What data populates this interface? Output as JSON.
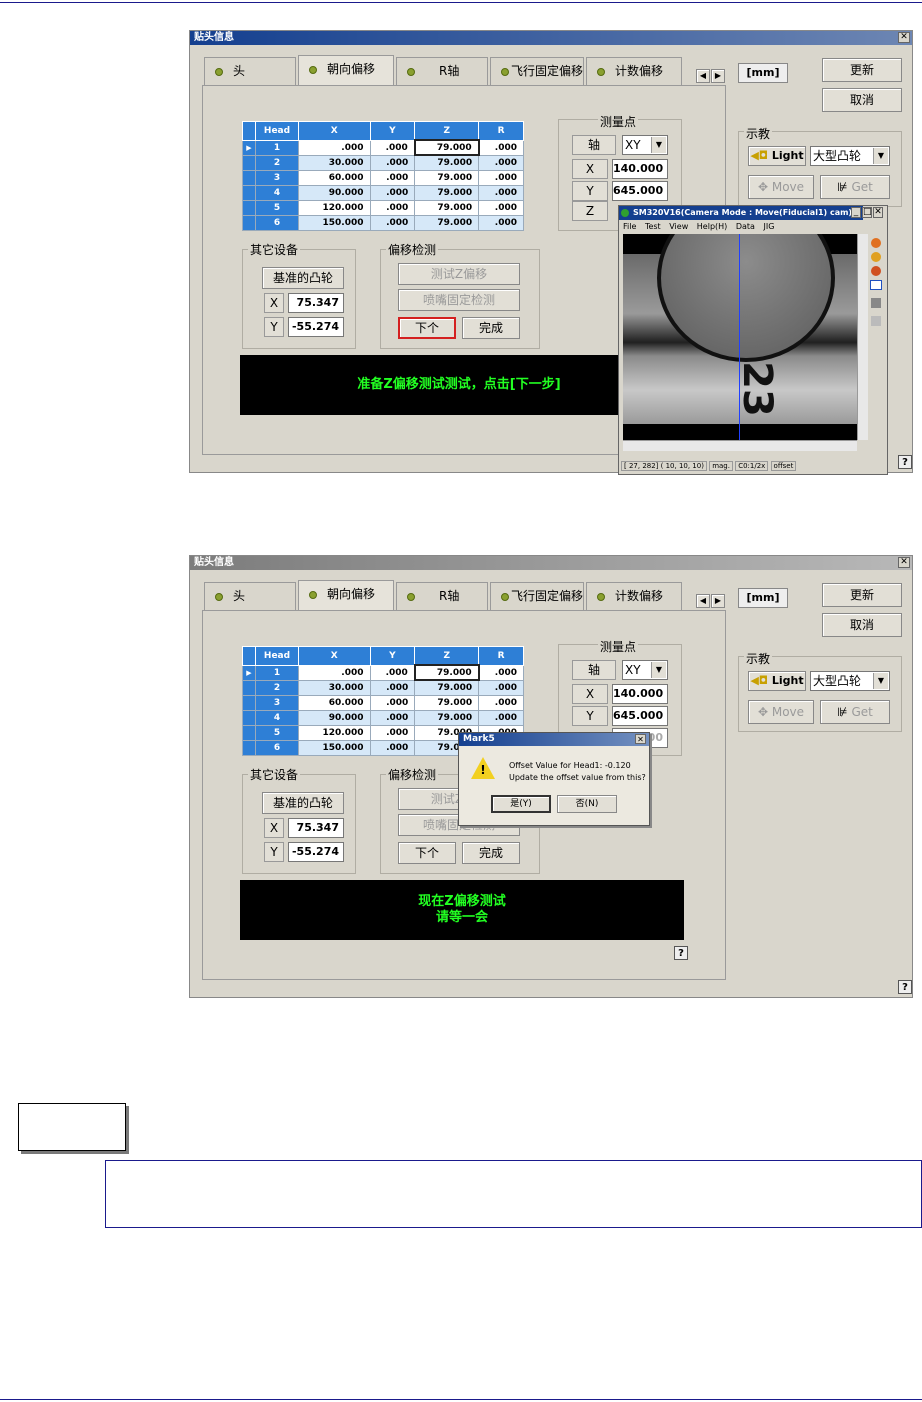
{
  "window_title": "贴头信息",
  "tabs": [
    "头",
    "朝向偏移",
    "R轴",
    "飞行固定偏移",
    "计数偏移"
  ],
  "unit": "[mm]",
  "buttons": {
    "update": "更新",
    "cancel": "取消",
    "next": "下个",
    "finish": "完成",
    "test_z": "测试Z偏移",
    "nozzle_check": "喷嘴固定检测",
    "move": "Move",
    "get": "Get",
    "light": "Light"
  },
  "teach": {
    "label": "示教",
    "camera_select": "大型凸轮"
  },
  "measure": {
    "label": "测量点",
    "axis_label": "轴",
    "axis_value": "XY",
    "x_label": "X",
    "x_value": "140.000",
    "y_label": "Y",
    "y_value": "645.000",
    "z_label": "Z",
    "z_value": "000"
  },
  "table": {
    "headers": [
      "Head",
      "X",
      "Y",
      "Z",
      "R"
    ],
    "rows": [
      [
        "1",
        ".000",
        ".000",
        "79.000",
        ".000"
      ],
      [
        "2",
        "30.000",
        ".000",
        "79.000",
        ".000"
      ],
      [
        "3",
        "60.000",
        ".000",
        "79.000",
        ".000"
      ],
      [
        "4",
        "90.000",
        ".000",
        "79.000",
        ".000"
      ],
      [
        "5",
        "120.000",
        ".000",
        "79.000",
        ".000"
      ],
      [
        "6",
        "150.000",
        ".000",
        "79.000",
        ".000"
      ]
    ]
  },
  "other": {
    "label": "其它设备",
    "ref_camera": "基准的凸轮",
    "x_label": "X",
    "x_value": "75.347",
    "y_label": "Y",
    "y_value": "-55.274"
  },
  "offset_check": {
    "label": "偏移检测"
  },
  "message1": "准备Z偏移测试测试，点击[下一步]",
  "message2_line1": "现在Z偏移测试",
  "message2_line2": "请等一会",
  "camera_window": {
    "title": "SM320V16(Camera Mode : Move(Fiducial1) cam)",
    "menu": [
      "File",
      "Test",
      "View",
      "Help(H)",
      "Data",
      "JIG"
    ],
    "status": [
      "[ 27, 282] ( 10, 10, 10)",
      "mag.",
      "C0:1/2x",
      "offset"
    ],
    "overlay_text": "23"
  },
  "dialog": {
    "title": "Mark5",
    "line1": "Offset Value for Head1: -0.120",
    "line2": "Update the offset value from this?",
    "yes": "是(Y)",
    "no": "否(N)"
  },
  "help": "?"
}
